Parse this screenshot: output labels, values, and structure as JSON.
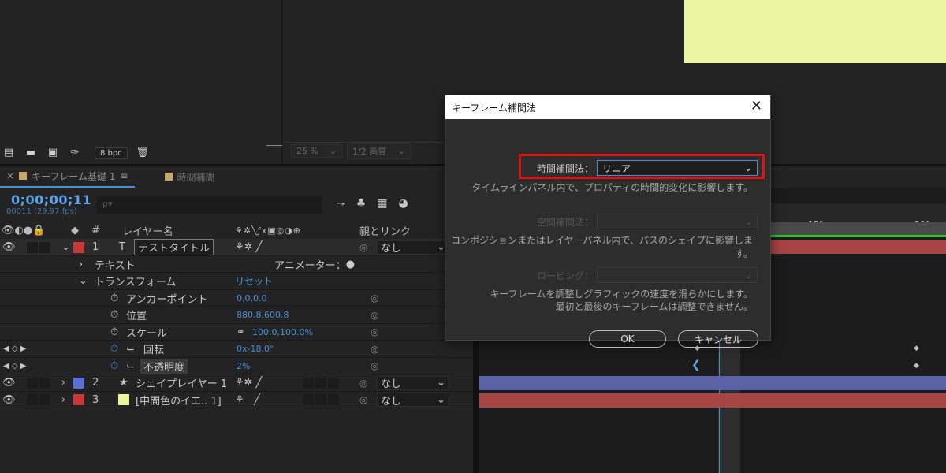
{
  "project_panel": {
    "bpc_label": "8 bpc"
  },
  "viewer": {
    "zoom": "25 %",
    "resolution": "1/2 画質"
  },
  "tabs": [
    {
      "label": "キーフレーム基礎 1",
      "swatch": "#c8a86a"
    },
    {
      "label": "時間補間",
      "swatch": "#c8a86a"
    }
  ],
  "timeline": {
    "timecode": "0;00;00;11",
    "fps": "00011 (29.97 fps)",
    "search_placeholder": "ρ▾",
    "columns": {
      "layer_name": "レイヤー名",
      "number": "#",
      "parent": "親とリンク"
    },
    "layers": [
      {
        "number": "1",
        "type_icon": "T",
        "name": "テストタイトル",
        "color": "#c73838",
        "parent": "なし"
      },
      {
        "number": "2",
        "type_icon": "★",
        "name": "シェイプレイヤー 1",
        "color": "#5b6fd6",
        "parent": "なし"
      },
      {
        "number": "3",
        "type_icon": "□",
        "name": "[中間色のイエ.. 1]",
        "color": "#c73838",
        "parent": "なし"
      }
    ],
    "text_group": "テキスト",
    "animator": "アニメーター：",
    "transform_group": "トランスフォーム",
    "reset": "リセット",
    "properties": [
      {
        "name": "アンカーポイント",
        "value": "0.0,0.0"
      },
      {
        "name": "位置",
        "value": "880.8,600.8"
      },
      {
        "name": "スケール",
        "value": "100.0,100.0%"
      },
      {
        "name": "回転",
        "value": "0x-18.0°"
      },
      {
        "name": "不透明度",
        "value": "2%"
      }
    ],
    "ruler_ticks": [
      "15f",
      "20f"
    ]
  },
  "dialog": {
    "title": "キーフレーム補間法",
    "temporal_label": "時間補間法：",
    "temporal_value": "リニア",
    "temporal_desc": "タイムラインパネル内で、プロパティの時間的変化に影響します。",
    "spatial_label": "空間補間法：",
    "spatial_desc": "コンポジションまたはレイヤーパネル内で、パスのシェイプに影響します。",
    "roving_label": "ロービング：",
    "roving_desc_1": "キーフレームを調整しグラフィックの速度を滑らかにします。",
    "roving_desc_2": "最初と最後のキーフレームは調整できません。",
    "ok": "OK",
    "cancel": "キャンセル"
  },
  "colors": {
    "accent": "#4a90d9",
    "highlight": "#e01212",
    "comp_background": "#ecf59f"
  }
}
